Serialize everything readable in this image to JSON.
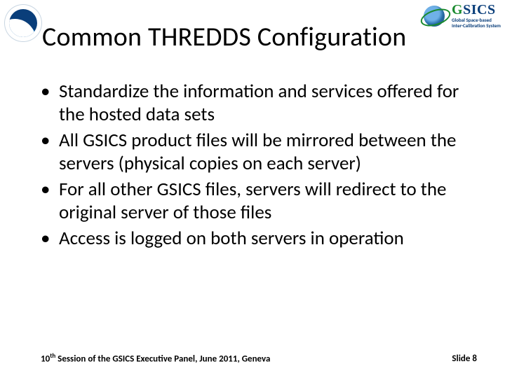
{
  "title": "Common THREDDS Configuration",
  "bullets": [
    "Standardize the information and services offered for the hosted data sets",
    "All GSICS product files will be mirrored between the servers (physical copies on each server)",
    "For all other GSICS files, servers will redirect to the original server of those files",
    "Access is logged on both servers in operation"
  ],
  "footer": {
    "session_ordinal": "10",
    "session_suffix": "th",
    "session_rest": " Session of the GSICS Executive Panel, June 2011, Geneva",
    "slide_label": "Slide 8"
  },
  "logos": {
    "left_name": "noaa-logo",
    "right_name": "gsics-logo",
    "gsics_text": "SICS",
    "gsics_prefix": "G",
    "gsics_sub1": "Global Space-based",
    "gsics_sub2": "Inter-Calibration System"
  }
}
